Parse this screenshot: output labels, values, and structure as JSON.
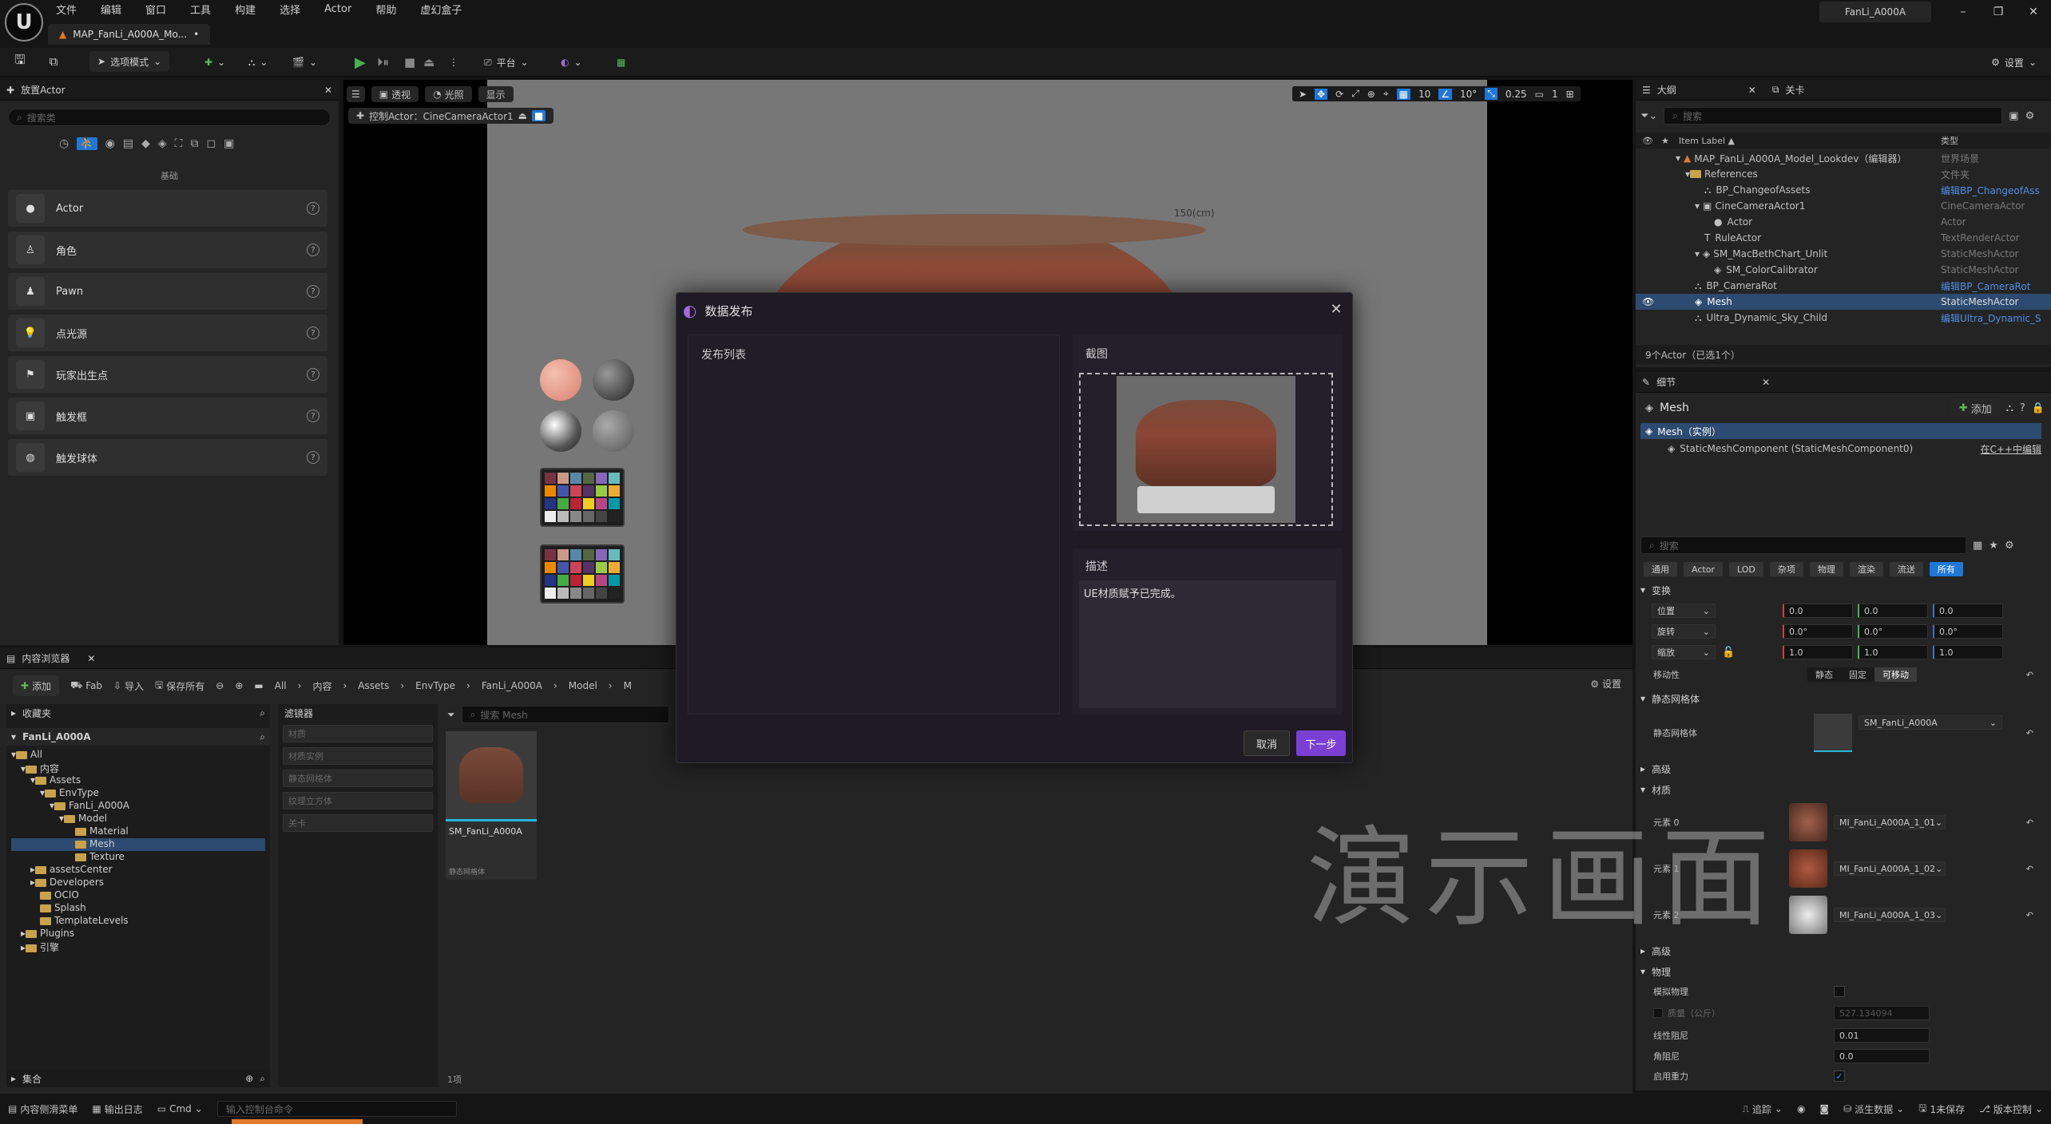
{
  "menubar": {
    "items": [
      "文件",
      "编辑",
      "窗口",
      "工具",
      "构建",
      "选择",
      "Actor",
      "帮助",
      "虚幻盒子"
    ],
    "project": "FanLi_A000A"
  },
  "tab": {
    "label": "MAP_FanLi_A000A_Mo..."
  },
  "toolbar": {
    "mode": "选项模式",
    "platform": "平台",
    "settings": "设置"
  },
  "place_actor": {
    "title": "放置Actor",
    "search_placeholder": "搜索类",
    "category": "基础",
    "items": [
      "Actor",
      "角色",
      "Pawn",
      "点光源",
      "玩家出生点",
      "触发框",
      "触发球体"
    ]
  },
  "viewport": {
    "perspective": "透视",
    "lit": "光照",
    "show": "显示",
    "pilot": "控制Actor：CineCameraActor1",
    "grid": "10",
    "angle": "10°",
    "scale": "0.25",
    "cam": "1",
    "ruler": "150(cm)"
  },
  "dialog": {
    "title": "数据发布",
    "list_label": "发布列表",
    "screenshot_label": "截图",
    "desc_label": "描述",
    "desc_text": "UE材质赋予已完成。",
    "cancel": "取消",
    "next": "下一步"
  },
  "content_browser": {
    "title": "内容浏览器",
    "add": "添加",
    "fab": "Fab",
    "import": "导入",
    "saveall": "保存所有",
    "breadcrumb": [
      "All",
      "内容",
      "Assets",
      "EnvType",
      "FanLi_A000A",
      "Model",
      "M"
    ],
    "favorites": "收藏夹",
    "root": "FanLi_A000A",
    "tree": [
      "All",
      "内容",
      "Assets",
      "EnvType",
      "FanLi_A000A",
      "Model",
      "Material",
      "Mesh",
      "Texture",
      "assetsCenter",
      "Developers",
      "OCIO",
      "Splash",
      "TemplateLevels",
      "Plugins",
      "引擎"
    ],
    "filters_title": "滤镜器",
    "filters": [
      "材质",
      "材质实例",
      "静态网格体",
      "纹理立方体",
      "关卡"
    ],
    "search_placeholder": "搜索 Mesh",
    "asset_name": "SM_FanLi_A000A",
    "asset_type": "静态网格体",
    "count": "1项",
    "collections": "集合",
    "settings": "设置"
  },
  "outliner": {
    "title": "大纲",
    "tab2": "关卡",
    "search_placeholder": "搜索",
    "col_label": "Item Label ▲",
    "col_type": "类型",
    "rows": [
      {
        "label": "MAP_FanLi_A000A_Model_Lookdev（编辑器）",
        "type": "世界场景",
        "link": false
      },
      {
        "label": "References",
        "type": "文件夹",
        "link": false
      },
      {
        "label": "BP_ChangeofAssets",
        "type": "编辑BP_ChangeofAss",
        "link": true
      },
      {
        "label": "CineCameraActor1",
        "type": "CineCameraActor",
        "link": false
      },
      {
        "label": "Actor",
        "type": "Actor",
        "link": false
      },
      {
        "label": "RuleActor",
        "type": "TextRenderActor",
        "link": false
      },
      {
        "label": "SM_MacBethChart_Unlit",
        "type": "StaticMeshActor",
        "link": false
      },
      {
        "label": "SM_ColorCalibrator",
        "type": "StaticMeshActor",
        "link": false
      },
      {
        "label": "BP_CameraRot",
        "type": "编辑BP_CameraRot",
        "link": true
      },
      {
        "label": "Mesh",
        "type": "StaticMeshActor",
        "link": false
      },
      {
        "label": "Ultra_Dynamic_Sky_Child",
        "type": "编辑Ultra_Dynamic_S",
        "link": true
      }
    ],
    "count": "9个Actor（已选1个）"
  },
  "details": {
    "title": "细节",
    "actor": "Mesh",
    "add": "添加",
    "instance": "Mesh（实例）",
    "component": "StaticMeshComponent (StaticMeshComponent0)",
    "cpp": "在C++中编辑",
    "search_placeholder": "搜索",
    "filters": [
      "通用",
      "Actor",
      "LOD",
      "杂项",
      "物理",
      "渲染",
      "流送",
      "所有"
    ],
    "transform": "变换",
    "location": "位置",
    "rotation": "旋转",
    "scale": "缩放",
    "loc": [
      "0.0",
      "0.0",
      "0.0"
    ],
    "rot": [
      "0.0°",
      "0.0°",
      "0.0°"
    ],
    "scl": [
      "1.0",
      "1.0",
      "1.0"
    ],
    "mobility": "移动性",
    "mobility_opts": [
      "静态",
      "固定",
      "可移动"
    ],
    "static_mesh_section": "静态网格体",
    "static_mesh_label": "静态网格体",
    "static_mesh_value": "SM_FanLi_A000A",
    "advanced": "高级",
    "materials": "材质",
    "elements": [
      {
        "label": "元素 0",
        "value": "MI_FanLi_A000A_1_01"
      },
      {
        "label": "元素 1",
        "value": "MI_FanLi_A000A_1_02"
      },
      {
        "label": "元素 2",
        "value": "MI_FanLi_A000A_1_03"
      }
    ],
    "physics": "物理",
    "simulate": "模拟物理",
    "mass": "质量（公斤）",
    "mass_value": "527.134094",
    "linear_damping": "线性阻尼",
    "linear_value": "0.01",
    "angular_damping": "角阻尼",
    "angular_value": "0.0",
    "gravity": "启用重力"
  },
  "statusbar": {
    "drawer": "内容侧滑菜单",
    "log": "输出日志",
    "cmd": "Cmd",
    "cmd_placeholder": "输入控制台命令",
    "trace": "追踪",
    "derived": "派生数据",
    "unsaved": "1未保存",
    "source": "版本控制"
  },
  "watermark": "演示画面"
}
